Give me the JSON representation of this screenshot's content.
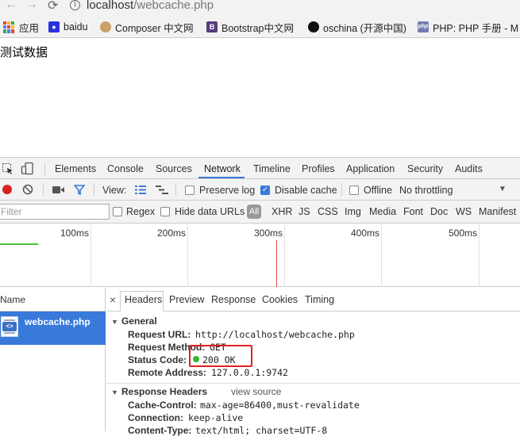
{
  "browser": {
    "url_host": "localhost",
    "url_path": "/webcache.php",
    "nav_back": "←",
    "nav_forward": "→",
    "reload": "⟳",
    "info": "i"
  },
  "bookmarks": [
    {
      "label": "应用",
      "icon": "apps-grid-icon",
      "color": "#4285f4"
    },
    {
      "label": "baidu",
      "icon": "baidu-paw-icon",
      "color": "#2932e1"
    },
    {
      "label": "Composer 中文网",
      "icon": "composer-icon",
      "color": "#8a6a44"
    },
    {
      "label": "Bootstrap中文网",
      "icon": "bootstrap-icon",
      "color": "#563d7c"
    },
    {
      "label": "oschina (开源中国)",
      "icon": "github-icon",
      "color": "#111111"
    },
    {
      "label": "PHP: PHP 手册 - M",
      "icon": "php-icon",
      "color": "#777bb3"
    }
  ],
  "page": {
    "body_text": "测试数据"
  },
  "devtools": {
    "tabs": [
      "Elements",
      "Console",
      "Sources",
      "Network",
      "Timeline",
      "Profiles",
      "Application",
      "Security",
      "Audits"
    ],
    "active_tab": "Network",
    "toolbar": {
      "view_label": "View:",
      "preserve_log": "Preserve log",
      "disable_cache": "Disable cache",
      "offline": "Offline",
      "throttling": "No throttling"
    },
    "filter": {
      "placeholder": "Filter",
      "regex": "Regex",
      "hide_data_urls": "Hide data URLs",
      "all": "All",
      "types": [
        "XHR",
        "JS",
        "CSS",
        "Img",
        "Media",
        "Font",
        "Doc",
        "WS",
        "Manifest"
      ]
    },
    "timeline_ticks": [
      "100ms",
      "200ms",
      "300ms",
      "400ms",
      "500ms"
    ],
    "requests": {
      "name_header": "Name",
      "items": [
        {
          "name": "webcache.php"
        }
      ]
    },
    "detail": {
      "close": "×",
      "tabs": [
        "Headers",
        "Preview",
        "Response",
        "Cookies",
        "Timing"
      ],
      "active_tab": "Headers",
      "general_title": "General",
      "general": [
        {
          "key": "Request URL:",
          "value": "http://localhost/webcache.php"
        },
        {
          "key": "Request Method:",
          "value": "GET"
        },
        {
          "key": "Status Code:",
          "value": "200 OK"
        },
        {
          "key": "Remote Address:",
          "value": "127.0.0.1:9742"
        }
      ],
      "response_title": "Response Headers",
      "view_source": "view source",
      "response": [
        {
          "key": "Cache-Control:",
          "value": "max-age=86400,must-revalidate"
        },
        {
          "key": "Connection:",
          "value": "keep-alive"
        },
        {
          "key": "Content-Type:",
          "value": "text/html; charset=UTF-8"
        }
      ]
    }
  }
}
